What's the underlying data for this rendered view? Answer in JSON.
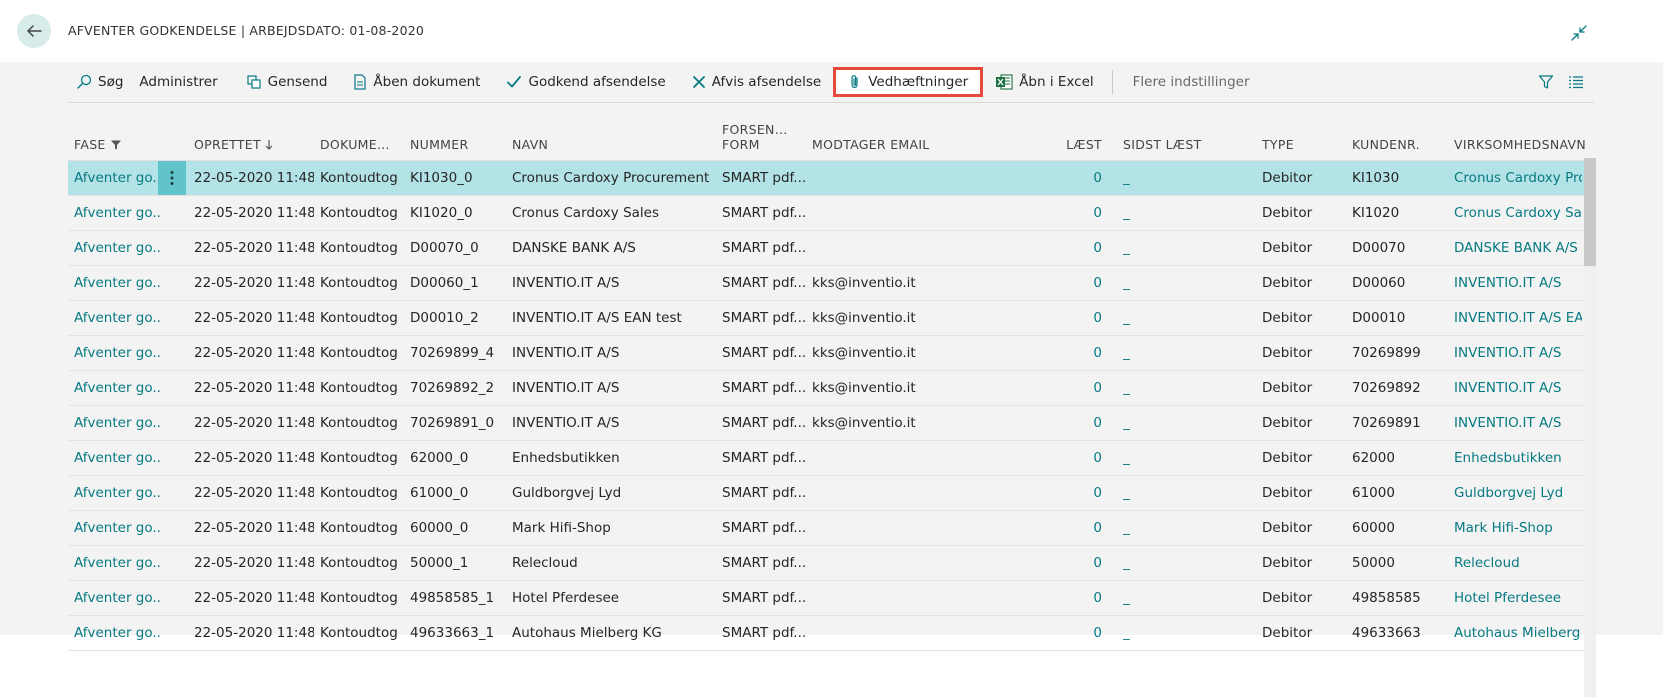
{
  "header": {
    "title": "AFVENTER GODKENDELSE | ARBEJDSDATO: 01-08-2020"
  },
  "toolbar": {
    "search": "Søg",
    "administrer": "Administrer",
    "gensend": "Gensend",
    "aaben_dokument": "Åben dokument",
    "godkend": "Godkend afsendelse",
    "afvis": "Afvis afsendelse",
    "vedhaeftninger": "Vedhæftninger",
    "excel": "Åbn i Excel",
    "flere": "Flere indstillinger"
  },
  "columns": {
    "fase": "FASE",
    "oprettet": "OPRETTET",
    "dokument": "DOKUME...",
    "nummer": "NUMMER",
    "navn": "NAVN",
    "forsen_1": "FORSEN...",
    "forsen_2": "FORM",
    "email": "MODTAGER EMAIL",
    "laest": "LÆST",
    "sidst": "SIDST LÆST",
    "type": "TYPE",
    "kundenr": "KUNDENR.",
    "virksomhed": "VIRKSOMHEDSNAVN"
  },
  "rows": [
    {
      "fase": "Afventer go...",
      "oprettet": "22-05-2020 11:48",
      "dok": "Kontoudtog",
      "nummer": "KI1030_0",
      "navn": "Cronus Cardoxy Procurement",
      "form": "SMART pdf...",
      "email": "",
      "laest": "0",
      "sidst": "_",
      "type": "Debitor",
      "kundenr": "KI1030",
      "virk": "Cronus Cardoxy Proc"
    },
    {
      "fase": "Afventer go...",
      "oprettet": "22-05-2020 11:48",
      "dok": "Kontoudtog",
      "nummer": "KI1020_0",
      "navn": "Cronus Cardoxy Sales",
      "form": "SMART pdf...",
      "email": "",
      "laest": "0",
      "sidst": "_",
      "type": "Debitor",
      "kundenr": "KI1020",
      "virk": "Cronus Cardoxy Sale"
    },
    {
      "fase": "Afventer go...",
      "oprettet": "22-05-2020 11:48",
      "dok": "Kontoudtog",
      "nummer": "D00070_0",
      "navn": "DANSKE BANK A/S",
      "form": "SMART pdf...",
      "email": "",
      "laest": "0",
      "sidst": "_",
      "type": "Debitor",
      "kundenr": "D00070",
      "virk": "DANSKE BANK A/S"
    },
    {
      "fase": "Afventer go...",
      "oprettet": "22-05-2020 11:48",
      "dok": "Kontoudtog",
      "nummer": "D00060_1",
      "navn": "INVENTIO.IT A/S",
      "form": "SMART pdf...",
      "email": "kks@inventio.it",
      "laest": "0",
      "sidst": "_",
      "type": "Debitor",
      "kundenr": "D00060",
      "virk": "INVENTIO.IT A/S"
    },
    {
      "fase": "Afventer go...",
      "oprettet": "22-05-2020 11:48",
      "dok": "Kontoudtog",
      "nummer": "D00010_2",
      "navn": "INVENTIO.IT A/S EAN test",
      "form": "SMART pdf...",
      "email": "kks@inventio.it",
      "laest": "0",
      "sidst": "_",
      "type": "Debitor",
      "kundenr": "D00010",
      "virk": "INVENTIO.IT A/S EAN"
    },
    {
      "fase": "Afventer go...",
      "oprettet": "22-05-2020 11:48",
      "dok": "Kontoudtog",
      "nummer": "70269899_4",
      "navn": "INVENTIO.IT A/S",
      "form": "SMART pdf...",
      "email": "kks@inventio.it",
      "laest": "0",
      "sidst": "_",
      "type": "Debitor",
      "kundenr": "70269899",
      "virk": "INVENTIO.IT A/S"
    },
    {
      "fase": "Afventer go...",
      "oprettet": "22-05-2020 11:48",
      "dok": "Kontoudtog",
      "nummer": "70269892_2",
      "navn": "INVENTIO.IT A/S",
      "form": "SMART pdf...",
      "email": "kks@inventio.it",
      "laest": "0",
      "sidst": "_",
      "type": "Debitor",
      "kundenr": "70269892",
      "virk": "INVENTIO.IT A/S"
    },
    {
      "fase": "Afventer go...",
      "oprettet": "22-05-2020 11:48",
      "dok": "Kontoudtog",
      "nummer": "70269891_0",
      "navn": "INVENTIO.IT A/S",
      "form": "SMART pdf...",
      "email": "kks@inventio.it",
      "laest": "0",
      "sidst": "_",
      "type": "Debitor",
      "kundenr": "70269891",
      "virk": "INVENTIO.IT A/S"
    },
    {
      "fase": "Afventer go...",
      "oprettet": "22-05-2020 11:48",
      "dok": "Kontoudtog",
      "nummer": "62000_0",
      "navn": "Enhedsbutikken",
      "form": "SMART pdf...",
      "email": "",
      "laest": "0",
      "sidst": "_",
      "type": "Debitor",
      "kundenr": "62000",
      "virk": "Enhedsbutikken"
    },
    {
      "fase": "Afventer go...",
      "oprettet": "22-05-2020 11:48",
      "dok": "Kontoudtog",
      "nummer": "61000_0",
      "navn": "Guldborgvej Lyd",
      "form": "SMART pdf...",
      "email": "",
      "laest": "0",
      "sidst": "_",
      "type": "Debitor",
      "kundenr": "61000",
      "virk": "Guldborgvej Lyd"
    },
    {
      "fase": "Afventer go...",
      "oprettet": "22-05-2020 11:48",
      "dok": "Kontoudtog",
      "nummer": "60000_0",
      "navn": "Mark Hifi-Shop",
      "form": "SMART pdf...",
      "email": "",
      "laest": "0",
      "sidst": "_",
      "type": "Debitor",
      "kundenr": "60000",
      "virk": "Mark Hifi-Shop"
    },
    {
      "fase": "Afventer go...",
      "oprettet": "22-05-2020 11:48",
      "dok": "Kontoudtog",
      "nummer": "50000_1",
      "navn": "Relecloud",
      "form": "SMART pdf...",
      "email": "",
      "laest": "0",
      "sidst": "_",
      "type": "Debitor",
      "kundenr": "50000",
      "virk": "Relecloud"
    },
    {
      "fase": "Afventer go...",
      "oprettet": "22-05-2020 11:48",
      "dok": "Kontoudtog",
      "nummer": "49858585_1",
      "navn": "Hotel Pferdesee",
      "form": "SMART pdf...",
      "email": "",
      "laest": "0",
      "sidst": "_",
      "type": "Debitor",
      "kundenr": "49858585",
      "virk": "Hotel Pferdesee"
    },
    {
      "fase": "Afventer go...",
      "oprettet": "22-05-2020 11:48",
      "dok": "Kontoudtog",
      "nummer": "49633663_1",
      "navn": "Autohaus Mielberg KG",
      "form": "SMART pdf...",
      "email": "",
      "laest": "0",
      "sidst": "_",
      "type": "Debitor",
      "kundenr": "49633663",
      "virk": "Autohaus Mielberg K"
    }
  ]
}
